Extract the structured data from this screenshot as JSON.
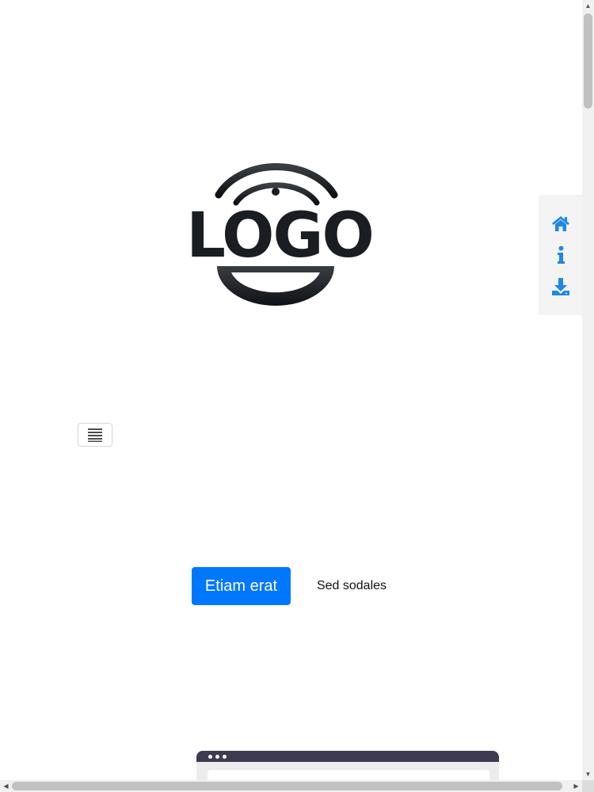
{
  "logo": {
    "text": "LOGO",
    "color": "#1a1d22"
  },
  "sidenav": {
    "background": "#f4f4f5",
    "accent": "#1e88e5",
    "items": [
      {
        "icon": "home-icon"
      },
      {
        "icon": "info-icon"
      },
      {
        "icon": "download-icon"
      }
    ]
  },
  "toggler": {
    "icon": "menu-icon"
  },
  "hero": {
    "primary_button": "Etiam erat",
    "secondary_link": "Sed sodales",
    "primary_color": "#0077ff"
  },
  "mockup": {
    "bar_color": "#3e3a52",
    "dots": 3
  }
}
